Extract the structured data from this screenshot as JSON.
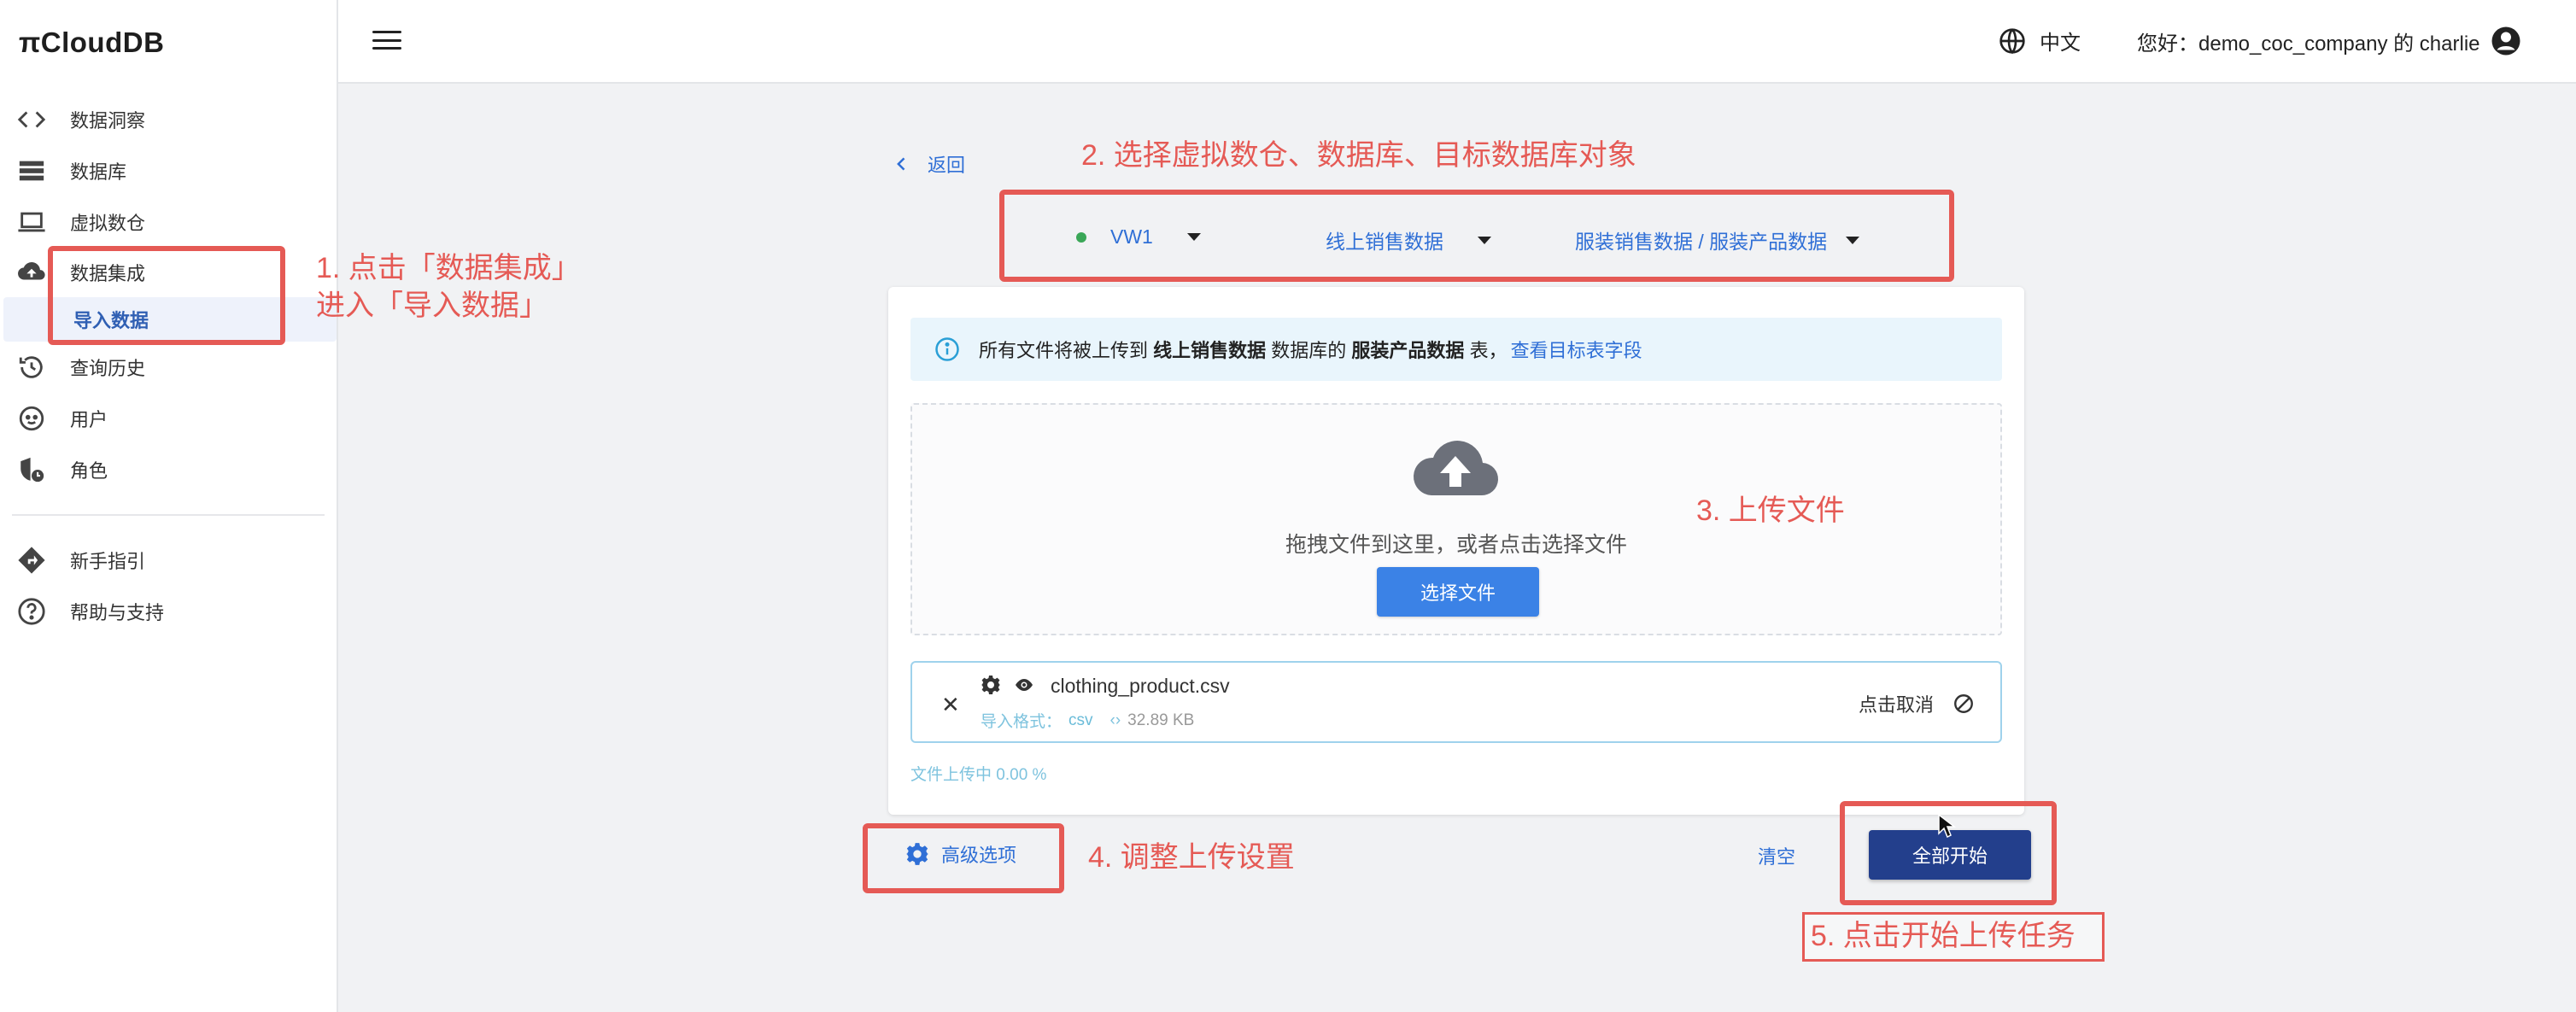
{
  "app": {
    "logo_text": "CloudDB",
    "logo_prefix": "π"
  },
  "sidebar": {
    "items": [
      {
        "label": "数据洞察",
        "icon": "code-icon"
      },
      {
        "label": "数据库",
        "icon": "database-list-icon"
      },
      {
        "label": "虚拟数仓",
        "icon": "laptop-icon"
      },
      {
        "label": "数据集成",
        "icon": "cloud-upload-icon"
      },
      {
        "label": "导入数据",
        "icon": ""
      },
      {
        "label": "查询历史",
        "icon": "history-icon"
      },
      {
        "label": "用户",
        "icon": "user-face-icon"
      },
      {
        "label": "角色",
        "icon": "shield-role-icon"
      },
      {
        "label": "新手指引",
        "icon": "directions-icon"
      },
      {
        "label": "帮助与支持",
        "icon": "help-icon"
      }
    ]
  },
  "header": {
    "language": "中文",
    "greeting": "您好：demo_coc_company 的 charlie"
  },
  "page": {
    "back_label": "返回",
    "selectors": {
      "warehouse": "VW1",
      "database": "线上销售数据",
      "table": "服装销售数据 / 服装产品数据"
    },
    "info": {
      "prefix": "所有文件将被上传到",
      "database": "线上销售数据",
      "middle": "数据库的",
      "table": "服装产品数据",
      "suffix": "表，",
      "link": "查看目标表字段"
    },
    "dropzone": {
      "text": "拖拽文件到这里，或者点击选择文件",
      "button": "选择文件"
    },
    "file": {
      "name": "clothing_product.csv",
      "format_label": "导入格式：",
      "format": "csv",
      "size": "32.89 KB",
      "cancel_label": "点击取消"
    },
    "progress": {
      "text": "文件上传中 0.00 %",
      "percent": 0
    },
    "actions": {
      "advanced": "高级选项",
      "clear": "清空",
      "start_all": "全部开始"
    }
  },
  "annotations": {
    "step1": [
      "1. 点击「数据集成」",
      "进入「导入数据」"
    ],
    "step2": "2. 选择虚拟数仓、数据库、目标数据库对象",
    "step3": "3. 上传文件",
    "step4": "4. 调整上传设置",
    "step5": "5. 点击开始上传任务",
    "color": "#e55a55"
  },
  "colors": {
    "accent": "#2f6fd6",
    "primary_button": "#3b82e6",
    "start_button": "#233f8c",
    "info_bg": "#e9f5fc",
    "status_dot": "#3aa757"
  }
}
